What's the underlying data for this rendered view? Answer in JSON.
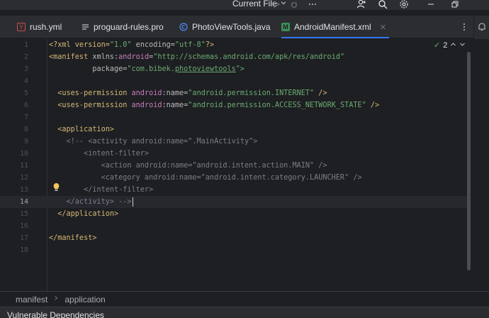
{
  "toolbar": {
    "run_config_label": "Current File",
    "icons": [
      "chevron-down-icon",
      "run-icon",
      "debug-icon",
      "more-icon",
      "add-user-icon",
      "search-icon",
      "settings-icon",
      "minimize-icon",
      "restore-icon"
    ]
  },
  "tabs": [
    {
      "label": "rush.yml",
      "icon": "yaml-file-icon",
      "active": false
    },
    {
      "label": "proguard-rules.pro",
      "icon": "text-file-icon",
      "active": false
    },
    {
      "label": "PhotoViewTools.java",
      "icon": "java-class-icon",
      "active": false
    },
    {
      "label": "AndroidManifest.xml",
      "icon": "manifest-file-icon",
      "active": true
    }
  ],
  "editor": {
    "line_numbers": [
      "1",
      "2",
      "3",
      "4",
      "5",
      "6",
      "7",
      "8",
      "9",
      "10",
      "11",
      "12",
      "13",
      "14",
      "15",
      "16",
      "17",
      "18"
    ],
    "current_line": "14",
    "inspection_count": "2",
    "lines": {
      "l1": [
        "<?xml version=",
        "\"1.0\"",
        " encoding=",
        "\"utf-8\"",
        "?>"
      ],
      "l2": [
        "<manifest",
        " xmlns:",
        "android",
        "=",
        "\"http://schemas.android.com/apk/res/android\""
      ],
      "l3": [
        "          package=",
        "\"com.bibek.",
        "photoviewtools",
        "\">"
      ],
      "l5": [
        "  <uses-permission",
        " android",
        ":name=",
        "\"android.permission.INTERNET\"",
        " />"
      ],
      "l6": [
        "  <uses-permission",
        " android",
        ":name=",
        "\"android.permission.ACCESS_NETWORK_STATE\"",
        " />"
      ],
      "l8": [
        "  <application",
        ">"
      ],
      "l9": "    <!-- <activity android:name=\".MainActivity\">",
      "l10": "        <intent-filter>",
      "l11": "            <action android:name=\"android.intent.action.MAIN\" />",
      "l12": "            <category android:name=\"android.intent.category.LAUNCHER\" />",
      "l13": "        </intent-filter>",
      "l14": "    </activity> -->",
      "l15": [
        "  </application",
        ">"
      ],
      "l17": [
        "</manifest",
        ">"
      ]
    }
  },
  "breadcrumb": [
    "manifest",
    "application"
  ],
  "bottom_panel": {
    "title": "Vulnerable Dependencies"
  },
  "colors": {
    "accent": "#3574f0",
    "tag": "#d5b778",
    "string": "#6aab73",
    "namespace": "#c77dbb",
    "comment": "#7a7e85"
  }
}
